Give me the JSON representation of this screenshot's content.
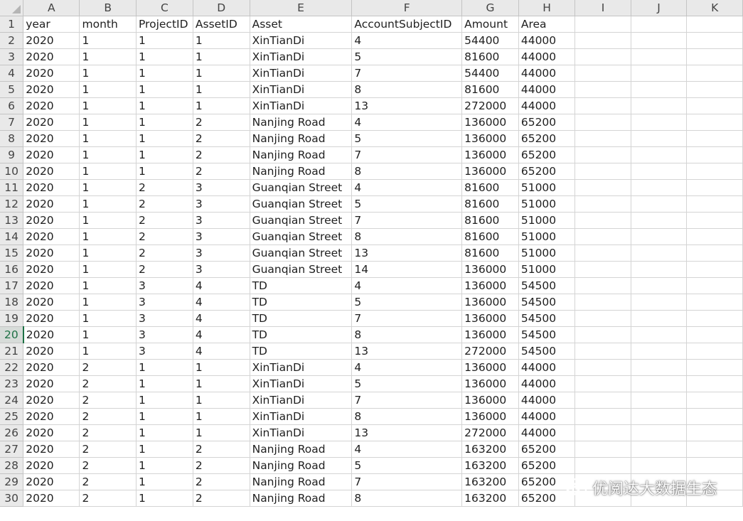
{
  "columns": [
    "A",
    "B",
    "C",
    "D",
    "E",
    "F",
    "G",
    "H",
    "I",
    "J",
    "K"
  ],
  "active_row": 20,
  "header_row": [
    "year",
    "month",
    "ProjectID",
    "AssetID",
    "Asset",
    "AccountSubjectID",
    "Amount",
    "Area",
    "",
    "",
    ""
  ],
  "rows": [
    [
      "2020",
      "1",
      "1",
      "1",
      "XinTianDi",
      "4",
      "54400",
      "44000",
      "",
      "",
      ""
    ],
    [
      "2020",
      "1",
      "1",
      "1",
      "XinTianDi",
      "5",
      "81600",
      "44000",
      "",
      "",
      ""
    ],
    [
      "2020",
      "1",
      "1",
      "1",
      "XinTianDi",
      "7",
      "54400",
      "44000",
      "",
      "",
      ""
    ],
    [
      "2020",
      "1",
      "1",
      "1",
      "XinTianDi",
      "8",
      "81600",
      "44000",
      "",
      "",
      ""
    ],
    [
      "2020",
      "1",
      "1",
      "1",
      "XinTianDi",
      "13",
      "272000",
      "44000",
      "",
      "",
      ""
    ],
    [
      "2020",
      "1",
      "1",
      "2",
      "Nanjing Road",
      "4",
      "136000",
      "65200",
      "",
      "",
      ""
    ],
    [
      "2020",
      "1",
      "1",
      "2",
      "Nanjing Road",
      "5",
      "136000",
      "65200",
      "",
      "",
      ""
    ],
    [
      "2020",
      "1",
      "1",
      "2",
      "Nanjing Road",
      "7",
      "136000",
      "65200",
      "",
      "",
      ""
    ],
    [
      "2020",
      "1",
      "1",
      "2",
      "Nanjing Road",
      "8",
      "136000",
      "65200",
      "",
      "",
      ""
    ],
    [
      "2020",
      "1",
      "2",
      "3",
      "Guanqian Street",
      "4",
      "81600",
      "51000",
      "",
      "",
      ""
    ],
    [
      "2020",
      "1",
      "2",
      "3",
      "Guanqian Street",
      "5",
      "81600",
      "51000",
      "",
      "",
      ""
    ],
    [
      "2020",
      "1",
      "2",
      "3",
      "Guanqian Street",
      "7",
      "81600",
      "51000",
      "",
      "",
      ""
    ],
    [
      "2020",
      "1",
      "2",
      "3",
      "Guanqian Street",
      "8",
      "81600",
      "51000",
      "",
      "",
      ""
    ],
    [
      "2020",
      "1",
      "2",
      "3",
      "Guanqian Street",
      "13",
      "81600",
      "51000",
      "",
      "",
      ""
    ],
    [
      "2020",
      "1",
      "2",
      "3",
      "Guanqian Street",
      "14",
      "136000",
      "51000",
      "",
      "",
      ""
    ],
    [
      "2020",
      "1",
      "3",
      "4",
      "TD",
      "4",
      "136000",
      "54500",
      "",
      "",
      ""
    ],
    [
      "2020",
      "1",
      "3",
      "4",
      "TD",
      "5",
      "136000",
      "54500",
      "",
      "",
      ""
    ],
    [
      "2020",
      "1",
      "3",
      "4",
      "TD",
      "7",
      "136000",
      "54500",
      "",
      "",
      ""
    ],
    [
      "2020",
      "1",
      "3",
      "4",
      "TD",
      "8",
      "136000",
      "54500",
      "",
      "",
      ""
    ],
    [
      "2020",
      "1",
      "3",
      "4",
      "TD",
      "13",
      "272000",
      "54500",
      "",
      "",
      ""
    ],
    [
      "2020",
      "2",
      "1",
      "1",
      "XinTianDi",
      "4",
      "136000",
      "44000",
      "",
      "",
      ""
    ],
    [
      "2020",
      "2",
      "1",
      "1",
      "XinTianDi",
      "5",
      "136000",
      "44000",
      "",
      "",
      ""
    ],
    [
      "2020",
      "2",
      "1",
      "1",
      "XinTianDi",
      "7",
      "136000",
      "44000",
      "",
      "",
      ""
    ],
    [
      "2020",
      "2",
      "1",
      "1",
      "XinTianDi",
      "8",
      "136000",
      "44000",
      "",
      "",
      ""
    ],
    [
      "2020",
      "2",
      "1",
      "1",
      "XinTianDi",
      "13",
      "272000",
      "44000",
      "",
      "",
      ""
    ],
    [
      "2020",
      "2",
      "1",
      "2",
      "Nanjing Road",
      "4",
      "163200",
      "65200",
      "",
      "",
      ""
    ],
    [
      "2020",
      "2",
      "1",
      "2",
      "Nanjing Road",
      "5",
      "163200",
      "65200",
      "",
      "",
      ""
    ],
    [
      "2020",
      "2",
      "1",
      "2",
      "Nanjing Road",
      "7",
      "163200",
      "65200",
      "",
      "",
      ""
    ],
    [
      "2020",
      "2",
      "1",
      "2",
      "Nanjing Road",
      "8",
      "163200",
      "65200",
      "",
      "",
      ""
    ]
  ],
  "watermark": {
    "text": "优阅达大数据生态",
    "icon": "wechat-icon"
  }
}
